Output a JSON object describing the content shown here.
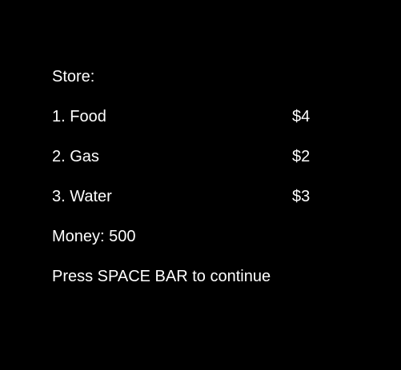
{
  "store": {
    "title": "Store:",
    "items": [
      {
        "label": "1. Food",
        "price": "$4"
      },
      {
        "label": "2. Gas",
        "price": "$2"
      },
      {
        "label": "3. Water",
        "price": "$3"
      }
    ]
  },
  "money_text": "Money: 500",
  "prompt_text": "Press SPACE BAR to continue",
  "colors": {
    "background": "#000000",
    "text": "#ffffff"
  }
}
